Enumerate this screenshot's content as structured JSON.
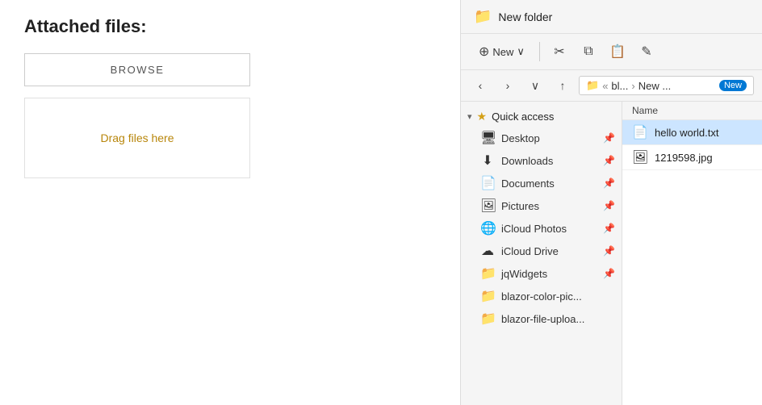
{
  "left": {
    "title": "Attached files:",
    "browse_label": "BROWSE",
    "drag_text": "Drag files here"
  },
  "explorer": {
    "titlebar": {
      "folder_icon": "📁",
      "title": "New folder"
    },
    "toolbar": {
      "new_label": "New",
      "new_chevron": "∨",
      "cut_icon": "✂",
      "copy_icon": "⧉",
      "paste_icon": "📋",
      "rename_icon": "✎"
    },
    "addressbar": {
      "back_icon": "‹",
      "forward_icon": "›",
      "dropdown_icon": "∨",
      "up_icon": "↑",
      "folder_icon": "📁",
      "breadcrumb_sep1": "«",
      "path1": "bl...",
      "path_sep": "›",
      "path2": "New ...",
      "new_badge": "New"
    },
    "sidebar": {
      "section_collapse": "▾",
      "section_star": "★",
      "section_label": "Quick access",
      "items": [
        {
          "icon": "🖥",
          "label": "Desktop",
          "pin": "📌"
        },
        {
          "icon": "⬇",
          "label": "Downloads",
          "pin": "📌"
        },
        {
          "icon": "📄",
          "label": "Documents",
          "pin": "📌"
        },
        {
          "icon": "🖼",
          "label": "Pictures",
          "pin": "📌"
        },
        {
          "icon": "🌐",
          "label": "iCloud Photos",
          "pin": "📌"
        },
        {
          "icon": "☁",
          "label": "iCloud Drive",
          "pin": "📌"
        },
        {
          "icon": "📁",
          "label": "jqWidgets",
          "pin": "📌"
        },
        {
          "icon": "📁",
          "label": "blazor-color-pic...",
          "pin": ""
        },
        {
          "icon": "📁",
          "label": "blazor-file-uploa...",
          "pin": ""
        }
      ]
    },
    "filelist": {
      "col_name": "Name",
      "files": [
        {
          "icon": "📄",
          "name": "hello world.txt",
          "selected": true
        },
        {
          "icon": "🖼",
          "name": "1219598.jpg",
          "selected": false
        }
      ]
    }
  }
}
